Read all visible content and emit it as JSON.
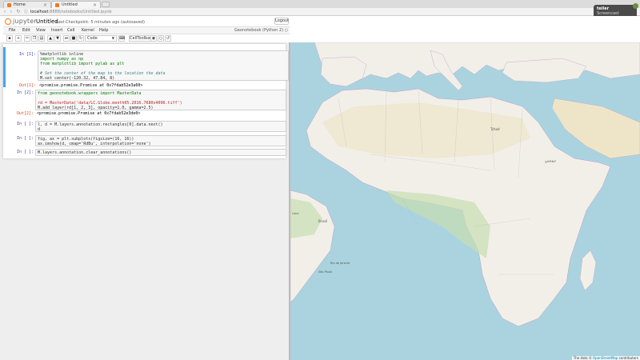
{
  "browser": {
    "tabs": [
      {
        "label": "Home"
      },
      {
        "label": "Untitled"
      }
    ],
    "url_host": "localhost",
    "url_path": ":8888/notebooks/Untitled.ipynb"
  },
  "notification": {
    "title": "teiler",
    "message": "Screencast started"
  },
  "jupyter": {
    "logo_text": "jupyter",
    "notebook_title": "Untitled",
    "checkpoint": "Last Checkpoint: 5 minutes ago (autosaved)",
    "logout_label": "Logout",
    "menu": [
      "File",
      "Edit",
      "View",
      "Insert",
      "Cell",
      "Kernel",
      "Help"
    ],
    "kernel_info": "Geonotebook (Python 2)",
    "toolbar": {
      "cell_type": "Code",
      "celltoolbar_label": "CellToolbar"
    }
  },
  "cells": [
    {
      "in_prompt": "In [1]:",
      "lines": [
        "%matplotlib inline",
        "import numpy as np",
        "from matplotlib import pylab as plt",
        "",
        "# Set the center of the map to the location the data",
        "M.set_center(-120.32, 47.84, 8)"
      ],
      "out_prompt": "Out[1]:",
      "output": "<promise.promise.Promise at 0x7fdab52e3a60>"
    },
    {
      "in_prompt": "In [2]:",
      "lines": [
        "from geonotebook.wrappers import MasterData",
        "",
        "rd = MasterData('data/LC.Globe.month05.2016.7680x4096.tiff')",
        "M.add_layer(rd[1, 2, 3], opacity=1.0, gamma=2.5)"
      ],
      "out_prompt": "Out[2]:",
      "output": "<promise.promise.Promise at 0x7fdab52e3de0>"
    },
    {
      "in_prompt": "In [ ]:",
      "lines": [
        "l, d = M.layers.annotation.rectangles[0].data.next()",
        "d"
      ]
    },
    {
      "in_prompt": "In [ ]:",
      "lines": [
        "fig, ax = plt.subplots(figsize=(16, 16))",
        "ax.imshow(d, cmap='RdBu', interpolation='none')"
      ]
    },
    {
      "in_prompt": "In [ ]:",
      "lines": [
        "M.layers.annotation.clear_annotations()"
      ]
    }
  ],
  "map": {
    "attribution_prefix": "The data ©",
    "attribution_link": "OpenStreetMap",
    "attribution_suffix": "contributors",
    "labels": {
      "brasil": "Brasil",
      "chad": "Tchad",
      "ethiopia": "ኢትዮጵያ",
      "lima": "Lima",
      "rio": "Rio de Janeiro",
      "sao_paulo": "São Paulo"
    },
    "colors": {
      "water": "#aad3df",
      "land": "#f2efe9",
      "green": "#c8deb0",
      "desert": "#eee5c8",
      "border": "#b9a3c6"
    }
  }
}
